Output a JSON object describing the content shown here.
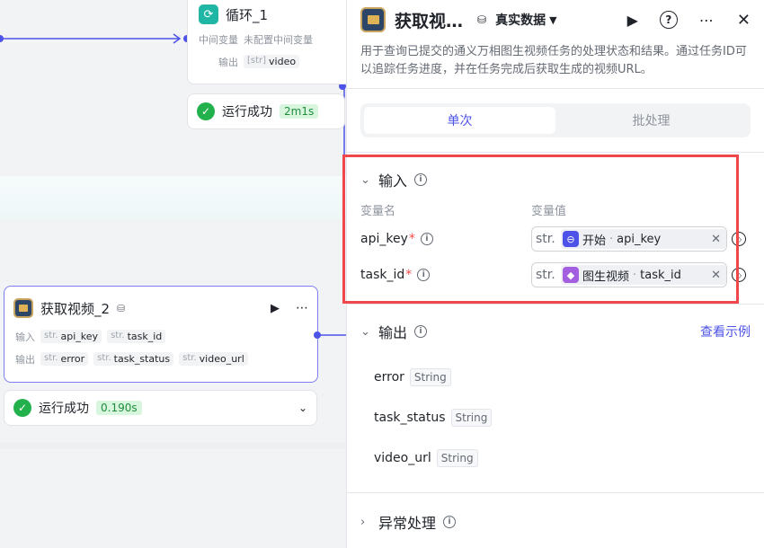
{
  "canvas": {
    "loop_node": {
      "title": "循环_1",
      "mid_label": "中间变量",
      "mid_value": "未配置中间变量",
      "out_label": "输出",
      "out_type": "[str]",
      "out_value": "video",
      "status": "运行成功",
      "time": "2m1s"
    },
    "video_node": {
      "title": "获取视频_2",
      "in_label": "输入",
      "inputs": [
        {
          "type": "str.",
          "name": "api_key"
        },
        {
          "type": "str.",
          "name": "task_id"
        }
      ],
      "out_label": "输出",
      "outputs": [
        {
          "type": "str.",
          "name": "error"
        },
        {
          "type": "str.",
          "name": "task_status"
        },
        {
          "type": "str.",
          "name": "video_url"
        }
      ],
      "status": "运行成功",
      "time": "0.190s"
    }
  },
  "panel": {
    "title": "获取视…",
    "data_mode": "真实数据",
    "description": "用于查询已提交的通义万相图生视频任务的处理状态和结果。通过任务ID可以追踪任务进度，并在任务完成后获取生成的视频URL。",
    "tabs": [
      "单次",
      "批处理"
    ],
    "input": {
      "section": "输入",
      "col_name": "变量名",
      "col_value": "变量值",
      "rows": [
        {
          "name": "api_key",
          "type": "str.",
          "source": "开始",
          "var": "api_key"
        },
        {
          "name": "task_id",
          "type": "str.",
          "source": "图生视频",
          "var": "task_id"
        }
      ]
    },
    "output": {
      "section": "输出",
      "example_link": "查看示例",
      "rows": [
        {
          "name": "error",
          "type": "String"
        },
        {
          "name": "task_status",
          "type": "String"
        },
        {
          "name": "video_url",
          "type": "String"
        }
      ]
    },
    "exception": "异常处理"
  }
}
